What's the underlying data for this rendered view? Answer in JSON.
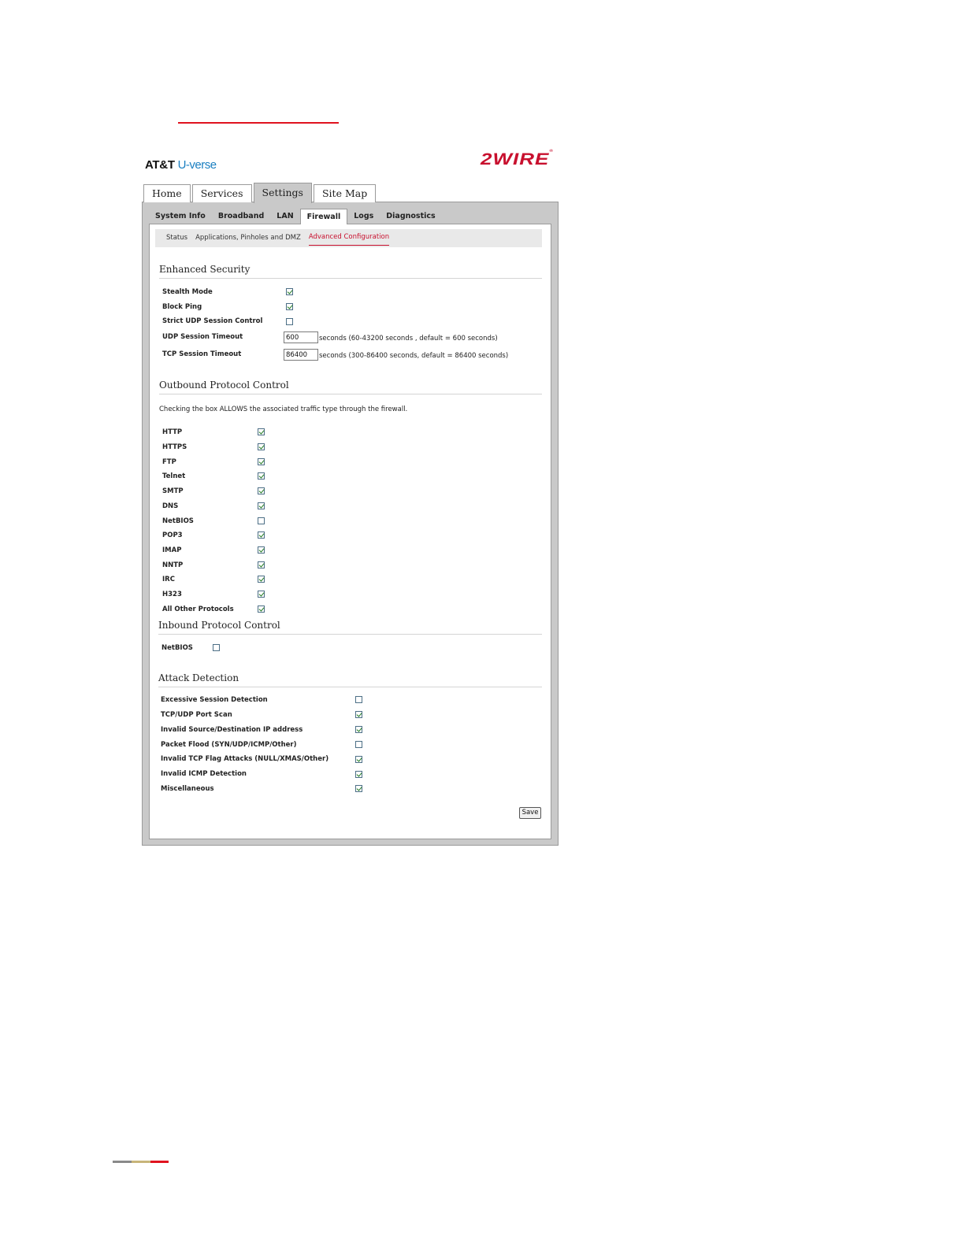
{
  "brand": {
    "att": "AT&T",
    "uverse": "U-verse",
    "logo": "2WIRE",
    "logo_mark": "®"
  },
  "top_tabs": [
    {
      "label": "Home"
    },
    {
      "label": "Services"
    },
    {
      "label": "Settings"
    },
    {
      "label": "Site Map"
    }
  ],
  "active_top_tab": "Settings",
  "sub_tabs": [
    {
      "label": "System Info"
    },
    {
      "label": "Broadband"
    },
    {
      "label": "LAN"
    },
    {
      "label": "Firewall"
    },
    {
      "label": "Logs"
    },
    {
      "label": "Diagnostics"
    }
  ],
  "active_sub_tab": "Firewall",
  "sub_nav": [
    {
      "label": "Status"
    },
    {
      "label": "Applications, Pinholes and DMZ"
    },
    {
      "label": "Advanced Configuration"
    }
  ],
  "active_sub_nav": "Advanced Configuration",
  "enhanced_security": {
    "title": "Enhanced Security",
    "stealth_mode": {
      "label": "Stealth Mode",
      "checked": true
    },
    "block_ping": {
      "label": "Block Ping",
      "checked": true
    },
    "strict_udp": {
      "label": "Strict UDP Session Control",
      "checked": false
    },
    "udp_timeout": {
      "label": "UDP Session Timeout",
      "value": "600",
      "hint": "seconds (60-43200 seconds , default = 600 seconds)"
    },
    "tcp_timeout": {
      "label": "TCP Session Timeout",
      "value": "86400",
      "hint": "seconds (300-86400 seconds, default = 86400 seconds)"
    }
  },
  "outbound": {
    "title": "Outbound Protocol Control",
    "description": "Checking the box ALLOWS the associated traffic type through the firewall.",
    "protocols": [
      {
        "label": "HTTP",
        "checked": true
      },
      {
        "label": "HTTPS",
        "checked": true
      },
      {
        "label": "FTP",
        "checked": true
      },
      {
        "label": "Telnet",
        "checked": true
      },
      {
        "label": "SMTP",
        "checked": true
      },
      {
        "label": "DNS",
        "checked": true
      },
      {
        "label": "NetBIOS",
        "checked": false
      },
      {
        "label": "POP3",
        "checked": true
      },
      {
        "label": "IMAP",
        "checked": true
      },
      {
        "label": "NNTP",
        "checked": true
      },
      {
        "label": "IRC",
        "checked": true
      },
      {
        "label": "H323",
        "checked": true
      },
      {
        "label": "All Other Protocols",
        "checked": true
      }
    ]
  },
  "inbound": {
    "title": "Inbound Protocol Control",
    "netbios": {
      "label": "NetBIOS",
      "checked": false
    }
  },
  "attack_detection": {
    "title": "Attack Detection",
    "items": [
      {
        "label": "Excessive Session Detection",
        "checked": false
      },
      {
        "label": "TCP/UDP Port Scan",
        "checked": true
      },
      {
        "label": "Invalid Source/Destination IP address",
        "checked": true
      },
      {
        "label": "Packet Flood (SYN/UDP/ICMP/Other)",
        "checked": false
      },
      {
        "label": "Invalid TCP Flag Attacks (NULL/XMAS/Other)",
        "checked": true
      },
      {
        "label": "Invalid ICMP Detection",
        "checked": true
      },
      {
        "label": "Miscellaneous",
        "checked": true
      }
    ]
  },
  "save_label": "Save",
  "colors": {
    "accent_red": "#c8102e",
    "uverse_blue": "#1a7fc1",
    "frame_gray": "#c9c9c9"
  }
}
